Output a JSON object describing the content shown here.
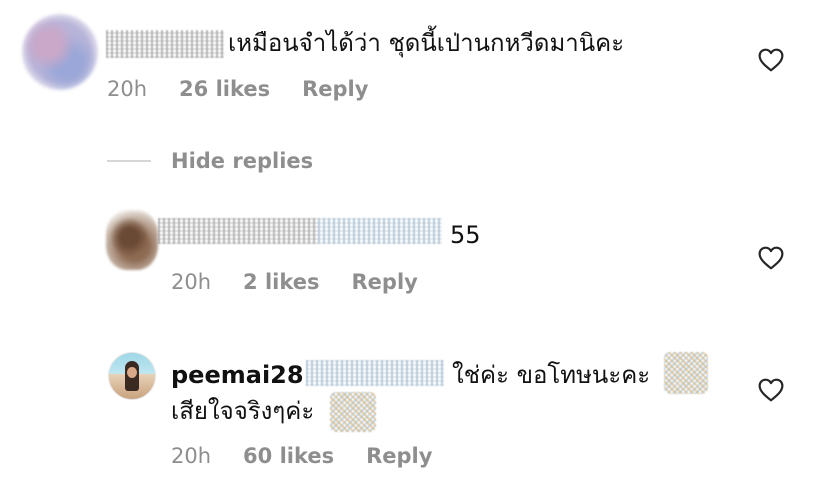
{
  "comments": [
    {
      "text": "เหมือนจำได้ว่า ชุดนี้เป่านกหวีดมานิคะ",
      "time": "20h",
      "likes": "26 likes",
      "reply": "Reply"
    }
  ],
  "thread": {
    "hide_replies": "Hide replies"
  },
  "replies": [
    {
      "text": "55",
      "time": "20h",
      "likes": "2 likes",
      "reply": "Reply"
    },
    {
      "username": "peemai28",
      "text_line1": "ใช่ค่ะ ขอโทษนะคะ",
      "text_line2": "เสียใจจริงๆค่ะ",
      "time": "20h",
      "likes": "60 likes",
      "reply": "Reply"
    }
  ],
  "icons": {
    "like": "heart-outline-icon"
  },
  "colors": {
    "text": "#111111",
    "meta": "#8e8e8e",
    "divider": "#d6d6d6"
  }
}
